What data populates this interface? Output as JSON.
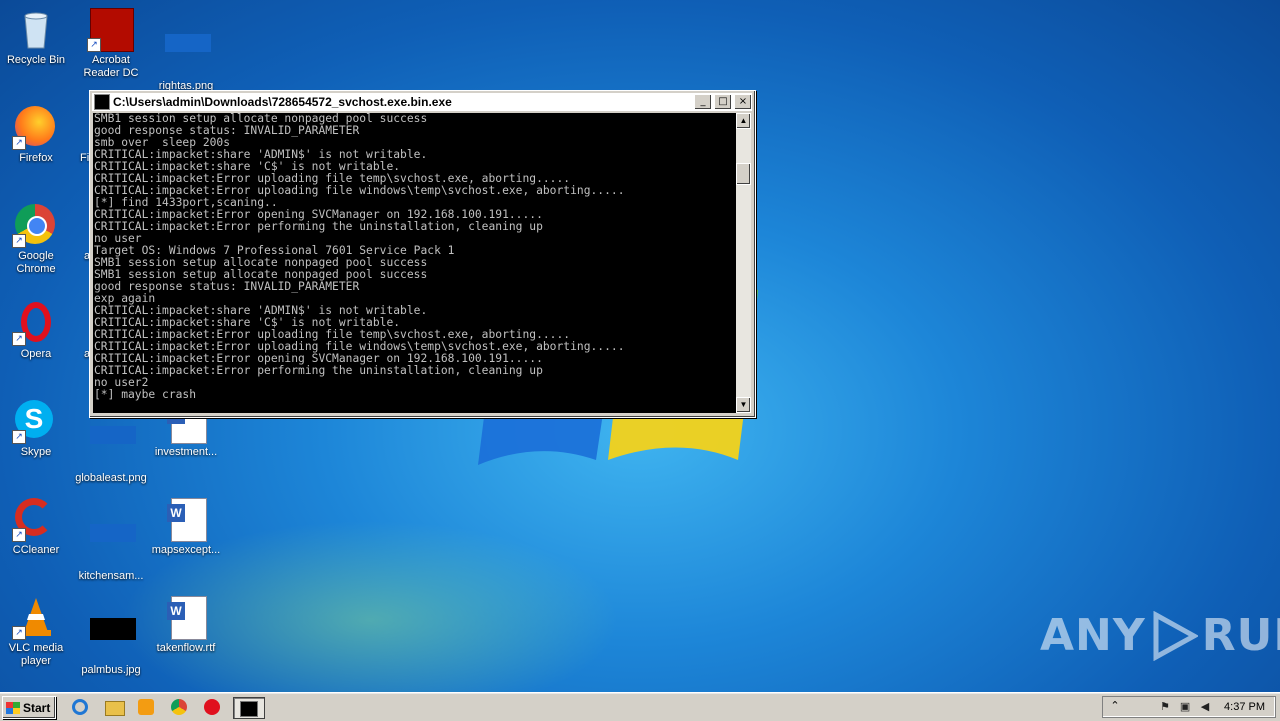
{
  "desktop": {
    "icons": [
      {
        "label": "Recycle Bin"
      },
      {
        "label": "Acrobat Reader DC"
      },
      {
        "label": "rightas.png"
      },
      {
        "label": "Firefox"
      },
      {
        "label": "Fi"
      },
      {
        "label": "Google Chrome"
      },
      {
        "label": "a"
      },
      {
        "label": "Opera"
      },
      {
        "label": "a"
      },
      {
        "label": "Skype"
      },
      {
        "label": "globaleast.png"
      },
      {
        "label": "investment..."
      },
      {
        "label": "CCleaner"
      },
      {
        "label": "kitchensam..."
      },
      {
        "label": "mapsexcept..."
      },
      {
        "label": "VLC media player"
      },
      {
        "label": "palmbus.jpg"
      },
      {
        "label": "takenflow.rtf"
      }
    ]
  },
  "console": {
    "title": "C:\\Users\\admin\\Downloads\\728654572_svchost.exe.bin.exe",
    "output": "SMB1 session setup allocate nonpaged pool success\ngood response status: INVALID_PARAMETER\nsmb over  sleep 200s\nCRITICAL:impacket:share 'ADMIN$' is not writable.\nCRITICAL:impacket:share 'C$' is not writable.\nCRITICAL:impacket:Error uploading file temp\\svchost.exe, aborting.....\nCRITICAL:impacket:Error uploading file windows\\temp\\svchost.exe, aborting.....\n[*] find 1433port,scaning..\nCRITICAL:impacket:Error opening SVCManager on 192.168.100.191.....\nCRITICAL:impacket:Error performing the uninstallation, cleaning up\nno user\nTarget OS: Windows 7 Professional 7601 Service Pack 1\nSMB1 session setup allocate nonpaged pool success\nSMB1 session setup allocate nonpaged pool success\ngood response status: INVALID_PARAMETER\nexp again\nCRITICAL:impacket:share 'ADMIN$' is not writable.\nCRITICAL:impacket:share 'C$' is not writable.\nCRITICAL:impacket:Error uploading file temp\\svchost.exe, aborting.....\nCRITICAL:impacket:Error uploading file windows\\temp\\svchost.exe, aborting.....\nCRITICAL:impacket:Error opening SVCManager on 192.168.100.191.....\nCRITICAL:impacket:Error performing the uninstallation, cleaning up\nno user2\n[*] maybe crash",
    "minimize_glyph": "_",
    "maximize_glyph": "□",
    "close_glyph": "×",
    "scroll_up_glyph": "▲",
    "scroll_down_glyph": "▼"
  },
  "taskbar": {
    "start_label": "Start",
    "clock": "4:37 PM",
    "tray_expand_glyph": "⌃"
  },
  "watermark": {
    "left": "ANY",
    "right": "RUN"
  }
}
